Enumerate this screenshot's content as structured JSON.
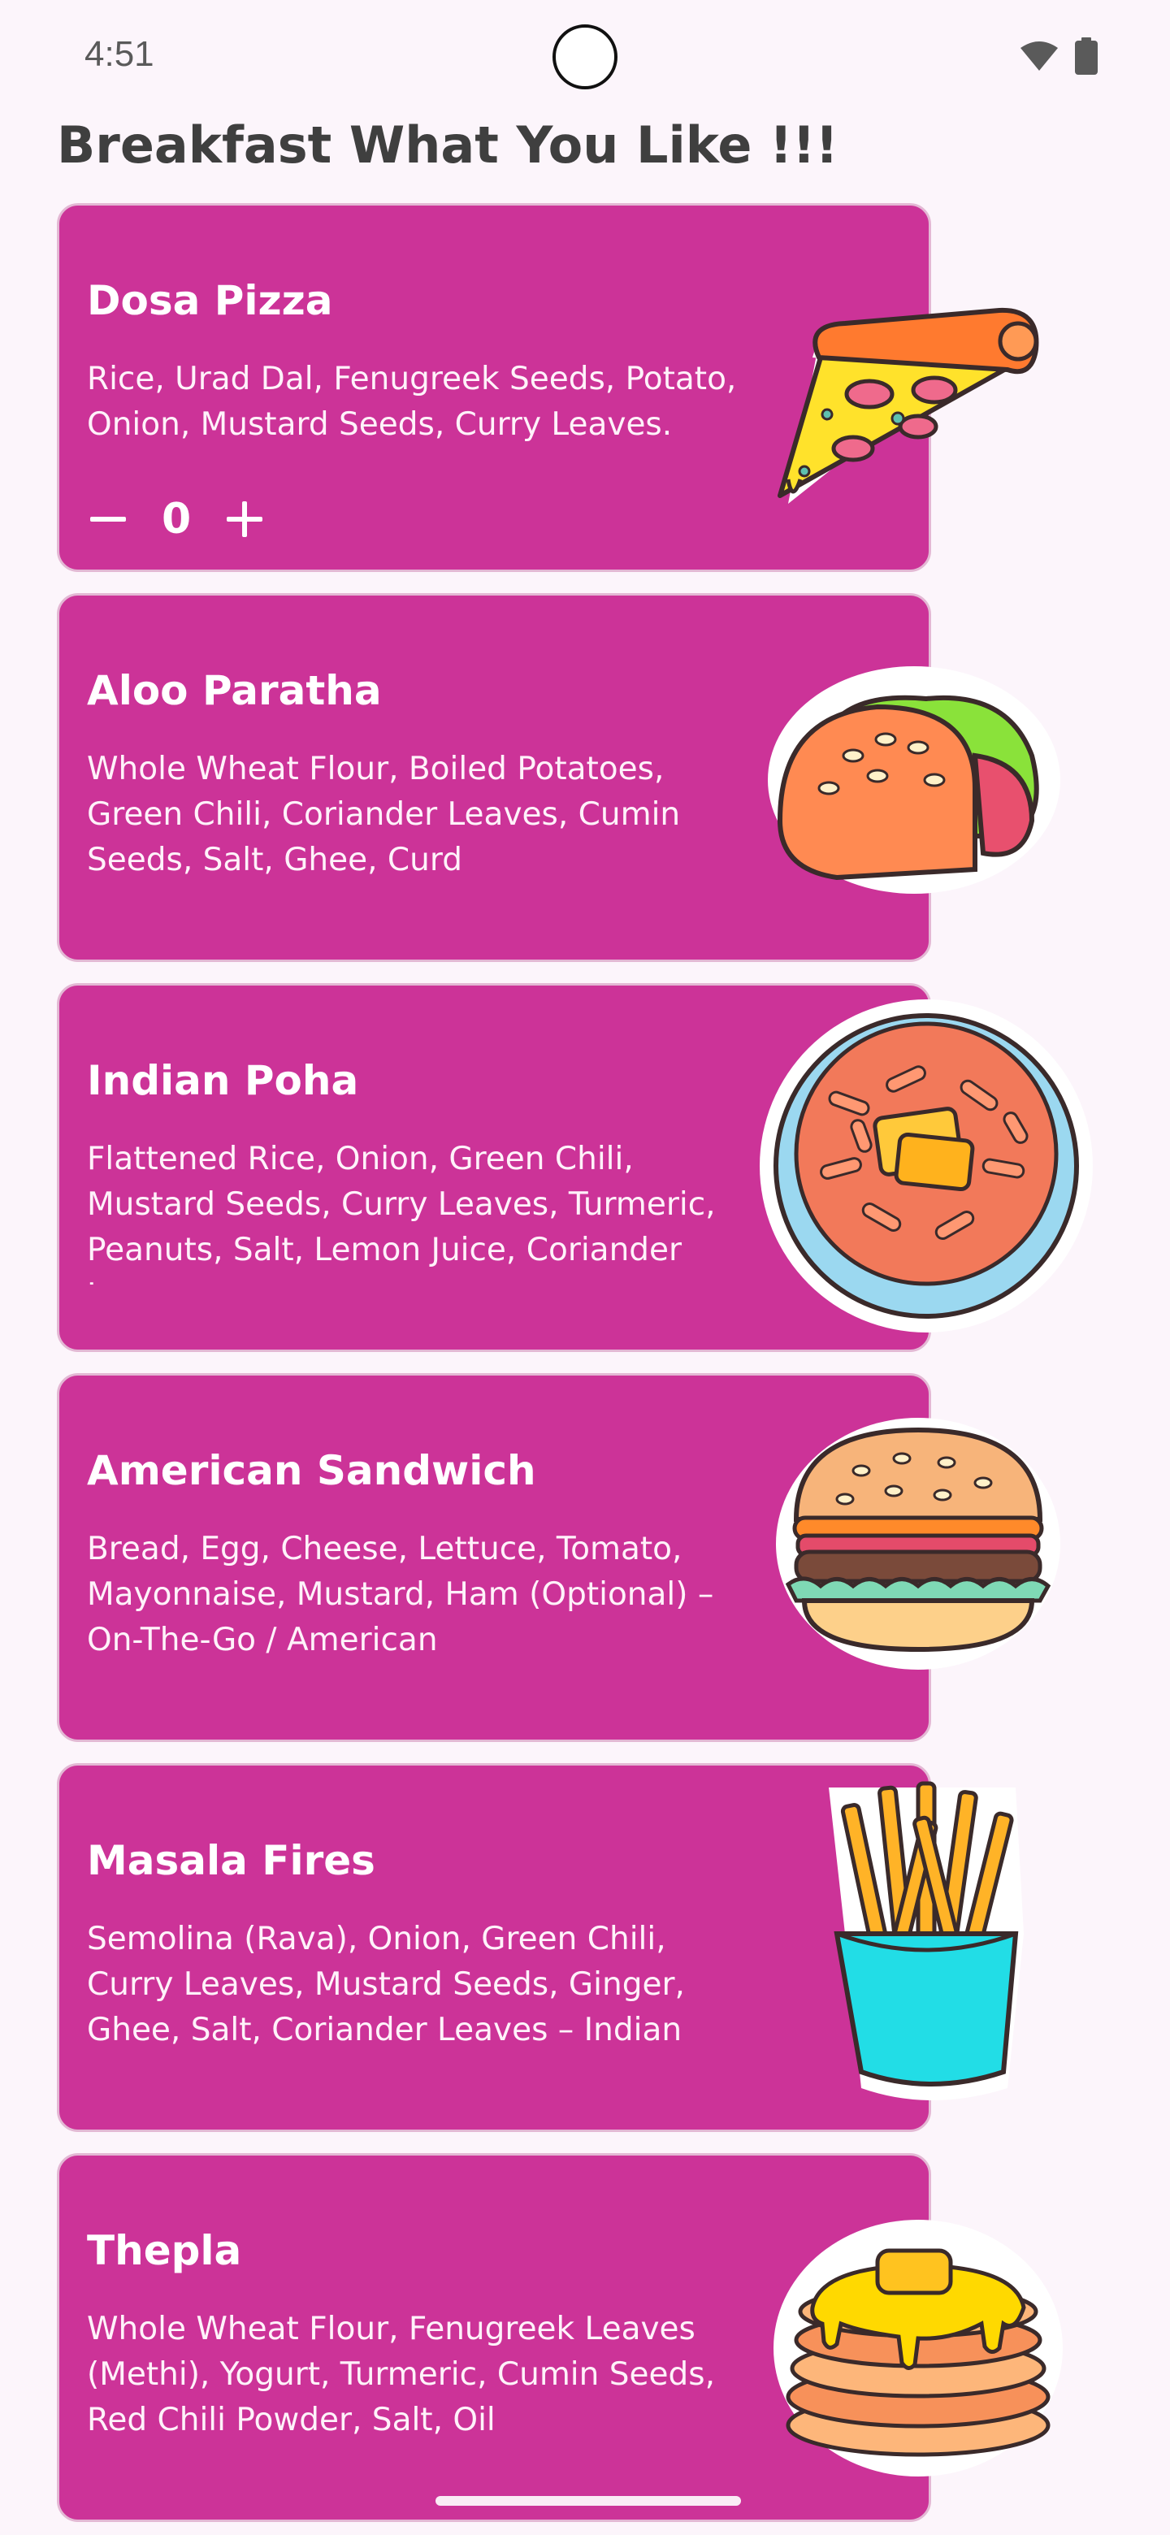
{
  "status_bar": {
    "time": "4:51"
  },
  "header": {
    "title": "Breakfast What You Like !!!"
  },
  "colors": {
    "card": "#cc3398",
    "background": "#fcf5fb",
    "title": "#3f3f3f"
  },
  "items": [
    {
      "title": "Dosa Pizza",
      "description": "Rice, Urad Dal, Fenugreek Seeds, Potato, Onion, Mustard Seeds, Curry Leaves.",
      "quantity": "0",
      "image_icon": "pizza-slice-icon"
    },
    {
      "title": "Aloo Paratha",
      "description": "Whole Wheat Flour, Boiled Potatoes, Green Chili, Coriander Leaves, Cumin Seeds, Salt, Ghee, Curd",
      "image_icon": "taco-icon"
    },
    {
      "title": "Indian Poha",
      "description": "Flattened Rice, Onion, Green Chili, Mustard Seeds, Curry Leaves, Turmeric, Peanuts, Salt, Lemon Juice, Coriander Leaves",
      "image_icon": "pasta-bowl-icon"
    },
    {
      "title": "American Sandwich",
      "description": "Bread, Egg, Cheese, Lettuce, Tomato, Mayonnaise, Mustard, Ham (Optional) – On-The-Go / American",
      "image_icon": "burger-icon"
    },
    {
      "title": "Masala Fires",
      "description": "Semolina (Rava), Onion, Green Chili, Curry Leaves, Mustard Seeds, Ginger, Ghee, Salt, Coriander Leaves – Indian",
      "image_icon": "french-fries-icon"
    },
    {
      "title": "Thepla",
      "description": "Whole Wheat Flour, Fenugreek Leaves (Methi), Yogurt, Turmeric, Cumin Seeds, Red Chili Powder, Salt, Oil",
      "image_icon": "pancakes-icon"
    }
  ]
}
